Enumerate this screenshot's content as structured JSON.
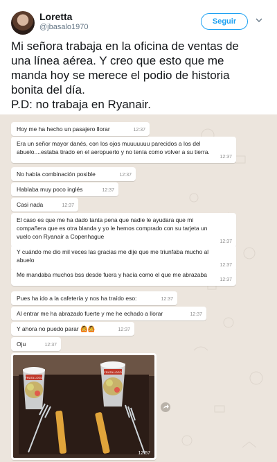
{
  "tweet": {
    "author_name": "Loretta",
    "author_handle": "@jbasalo1970",
    "follow_label": "Seguir",
    "text_lines": [
      "Mi señora trabaja en la oficina de ventas de",
      "una línea aérea. Y creo que esto que me",
      "manda hoy se merece el podio de historia",
      "bonita del día.",
      "P.D: no trabaja en Ryanair."
    ]
  },
  "chat": {
    "messages": [
      {
        "text": "Hoy me ha hecho un pasajero llorar",
        "time": "12:37"
      },
      {
        "text": "Era un señor mayor danés, con los ojos muuuuuuu parecidos a los del abuelo....estaba tirado en el aeropuerto y no tenía como volver a su tierra.",
        "time": "12:37"
      },
      {
        "text": "No había combinación posible",
        "time": "12:37"
      },
      {
        "text": "Hablaba muy poco inglés",
        "time": "12:37"
      },
      {
        "text": "Casi nada",
        "time": "12:37"
      },
      {
        "text": "El caso es que me ha dado tanta pena que nadie le ayudara que mi compañera que es otra blanda y yo le hemos comprado con su tarjeta un vuelo con Ryanair a Copenhague",
        "time": "12:37"
      },
      {
        "text": "Y cuándo me dio mil veces las gracias me dije que me triunfaba mucho al abuelo",
        "time": "12:37"
      },
      {
        "text": "Me mandaba muchos bss desde fuera y hacía como el que me abrazaba",
        "time": "12:37"
      },
      {
        "text": "Pues ha ido a la cafetería y nos ha traído eso:",
        "time": "12:37"
      },
      {
        "text": "Al entrar me ha abrazado fuerte y me he echado a llorar",
        "time": "12:37"
      },
      {
        "text": "Y ahora no puedo parar",
        "time": "12:37"
      },
      {
        "text": "Oju",
        "time": "12:37"
      }
    ],
    "photo_time": "12:57",
    "photo_cup_label": "FRUTA LOGO",
    "emoji_pair": "🙆🙆"
  },
  "colors": {
    "accent": "#1da1f2",
    "chat_background": "#ece5dd",
    "bubble": "#ffffff"
  }
}
